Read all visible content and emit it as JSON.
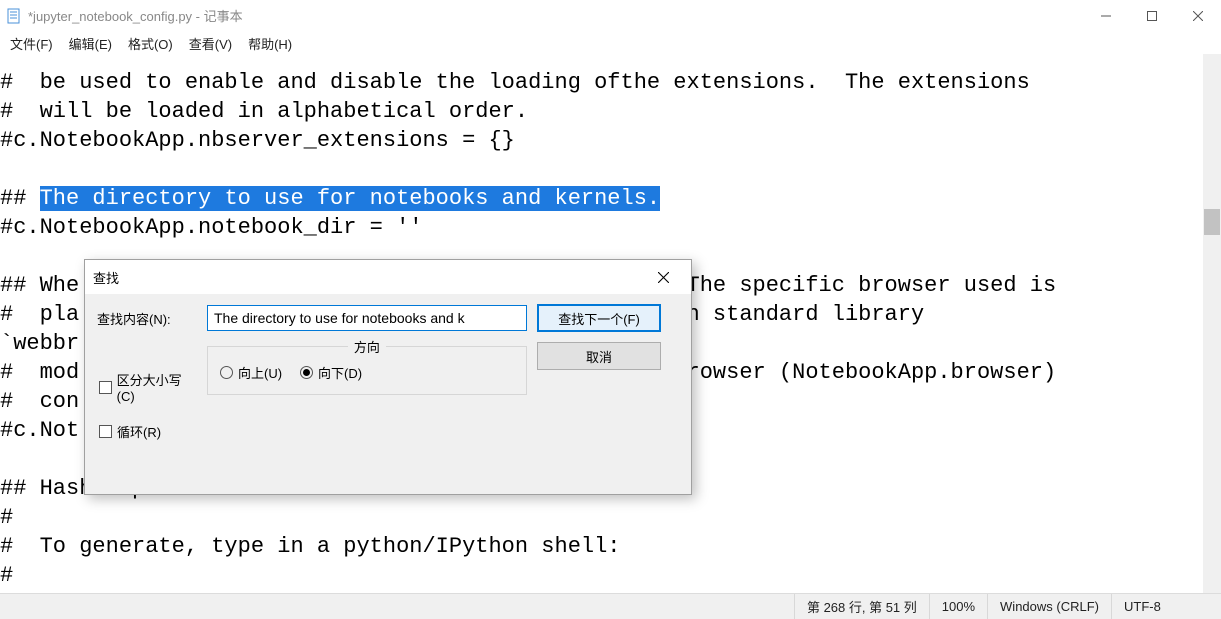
{
  "window": {
    "title": "*jupyter_notebook_config.py - 记事本"
  },
  "menu": {
    "file": "文件(F)",
    "edit": "编辑(E)",
    "format": "格式(O)",
    "view": "查看(V)",
    "help": "帮助(H)"
  },
  "editor": {
    "line1": "#  be used to enable and disable the loading ofthe extensions.  The extensions",
    "line2": "#  will be loaded in alphabetical order.",
    "line3": "#c.NotebookApp.nbserver_extensions = {}",
    "line4": "",
    "line5_pre": "## ",
    "line5_hl": "The directory to use for notebooks and kernels.",
    "line6": "#c.NotebookApp.notebook_dir = ''",
    "line7": "",
    "line8": "## Whe                                              The specific browser used is",
    "line9": "#  pla                                            hon standard library",
    "line10": "`webbr",
    "line11": "#  mod                                            -browser (NotebookApp.browser)",
    "line12": "#  con",
    "line13": "#c.Not",
    "line14": "",
    "line15": "## Hashed password to use for web authentication.",
    "line16": "#",
    "line17": "#  To generate, type in a python/IPython shell:",
    "line18": "#"
  },
  "find": {
    "title": "查找",
    "label": "查找内容(N):",
    "value": "The directory to use for notebooks and k",
    "next": "查找下一个(F)",
    "cancel": "取消",
    "direction_legend": "方向",
    "up": "向上(U)",
    "down": "向下(D)",
    "case": "区分大小写(C)",
    "wrap": "循环(R)"
  },
  "status": {
    "position": "第 268 行, 第 51 列",
    "zoom": "100%",
    "encoding_line": "Windows (CRLF)",
    "encoding": "UTF-8"
  }
}
